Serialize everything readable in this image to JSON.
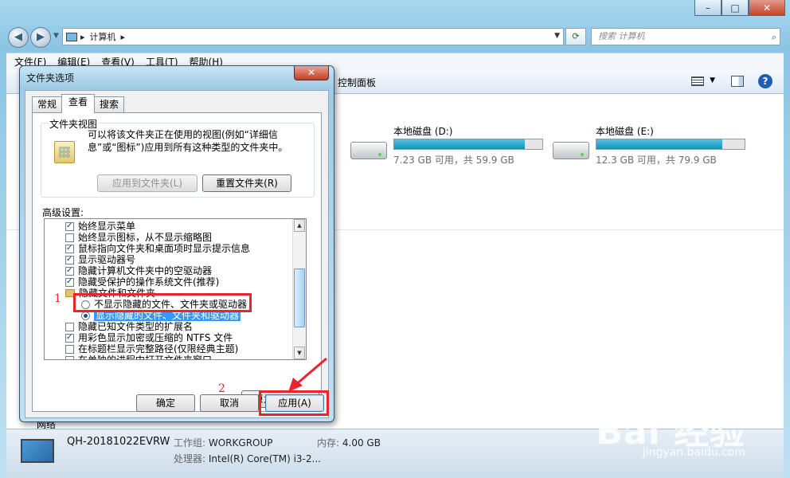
{
  "explorer": {
    "address_root": "计算机",
    "search_placeholder": "搜索 计算机",
    "menu": [
      "文件(F)",
      "编辑(E)",
      "查看(V)",
      "工具(T)",
      "帮助(H)"
    ],
    "toolbar_item": "控制面板",
    "drives": [
      {
        "name": "本地磁盘 (D:)",
        "size_text": "7.23 GB 可用，共 59.9 GB",
        "used_fraction": 0.88
      },
      {
        "name": "本地磁盘 (E:)",
        "size_text": "12.3 GB 可用，共 79.9 GB",
        "used_fraction": 0.85
      }
    ],
    "network_label": "网络",
    "details": {
      "computer_name": "QH-20181022EVRW",
      "workgroup_label": "工作组:",
      "workgroup_value": "WORKGROUP",
      "memory_label": "内存:",
      "memory_value": "4.00 GB",
      "processor_label": "处理器:",
      "processor_value": "Intel(R) Core(TM) i3-2..."
    },
    "window_buttons": {
      "minimize": "–",
      "maximize": "□",
      "close": "✕"
    }
  },
  "dialog": {
    "title": "文件夹选项",
    "close_label": "✕",
    "tabs": [
      "常规",
      "查看",
      "搜索"
    ],
    "active_tab": "查看",
    "folder_views": {
      "title": "文件夹视图",
      "description": "可以将该文件夹正在使用的视图(例如“详细信息”或“图标”)应用到所有这种类型的文件夹中。",
      "apply_button": "应用到文件夹(L)",
      "reset_button": "重置文件夹(R)"
    },
    "advanced_label": "高级设置:",
    "settings": [
      {
        "type": "checkbox",
        "checked": true,
        "label": "始终显示菜单"
      },
      {
        "type": "checkbox",
        "checked": false,
        "label": "始终显示图标，从不显示缩略图"
      },
      {
        "type": "checkbox",
        "checked": true,
        "label": "鼠标指向文件夹和桌面项时显示提示信息"
      },
      {
        "type": "checkbox",
        "checked": true,
        "label": "显示驱动器号"
      },
      {
        "type": "checkbox",
        "checked": true,
        "label": "隐藏计算机文件夹中的空驱动器"
      },
      {
        "type": "checkbox",
        "checked": true,
        "label": "隐藏受保护的操作系统文件(推荐)"
      },
      {
        "type": "folder",
        "label": "隐藏文件和文件夹"
      },
      {
        "type": "radio",
        "checked": false,
        "label": "不显示隐藏的文件、文件夹或驱动器"
      },
      {
        "type": "radio",
        "checked": true,
        "label": "显示隐藏的文件、文件夹和驱动器"
      },
      {
        "type": "checkbox",
        "checked": false,
        "label": "隐藏已知文件类型的扩展名"
      },
      {
        "type": "checkbox",
        "checked": true,
        "label": "用彩色显示加密或压缩的 NTFS 文件"
      },
      {
        "type": "checkbox",
        "checked": false,
        "label": "在标题栏显示完整路径(仅限经典主题)"
      },
      {
        "type": "checkbox",
        "checked": false,
        "label": "在单独的进程中打开文件夹窗口"
      }
    ],
    "restore_button": "还原为默认值(D)",
    "ok_button": "确定",
    "cancel_button": "取消",
    "apply_button": "应用(A)"
  },
  "annotations": {
    "step1": "1",
    "step2": "2",
    "color": "#e8252d"
  },
  "watermark": {
    "brand": "Bai  经验",
    "url": "jingyan.baidu.com"
  }
}
